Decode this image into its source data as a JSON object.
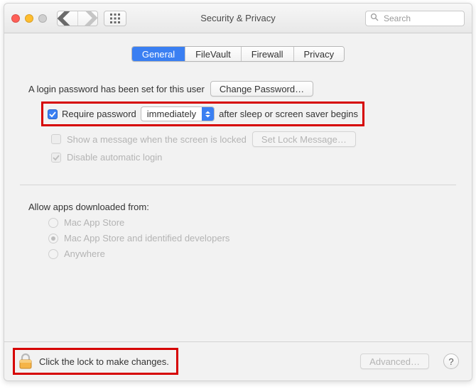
{
  "window": {
    "title": "Security & Privacy"
  },
  "search": {
    "placeholder": "Search"
  },
  "tabs": {
    "general": "General",
    "filevault": "FileVault",
    "firewall": "Firewall",
    "privacy": "Privacy"
  },
  "login": {
    "set_text": "A login password has been set for this user",
    "change_btn": "Change Password…",
    "require_prefix": "Require password",
    "require_delay": "immediately",
    "require_suffix": "after sleep or screen saver begins",
    "show_message": "Show a message when the screen is locked",
    "set_lock_msg_btn": "Set Lock Message…",
    "disable_auto": "Disable automatic login"
  },
  "gatekeeper": {
    "header": "Allow apps downloaded from:",
    "opt_store": "Mac App Store",
    "opt_identified": "Mac App Store and identified developers",
    "opt_anywhere": "Anywhere"
  },
  "footer": {
    "lock_text": "Click the lock to make changes.",
    "advanced_btn": "Advanced…",
    "help": "?"
  }
}
